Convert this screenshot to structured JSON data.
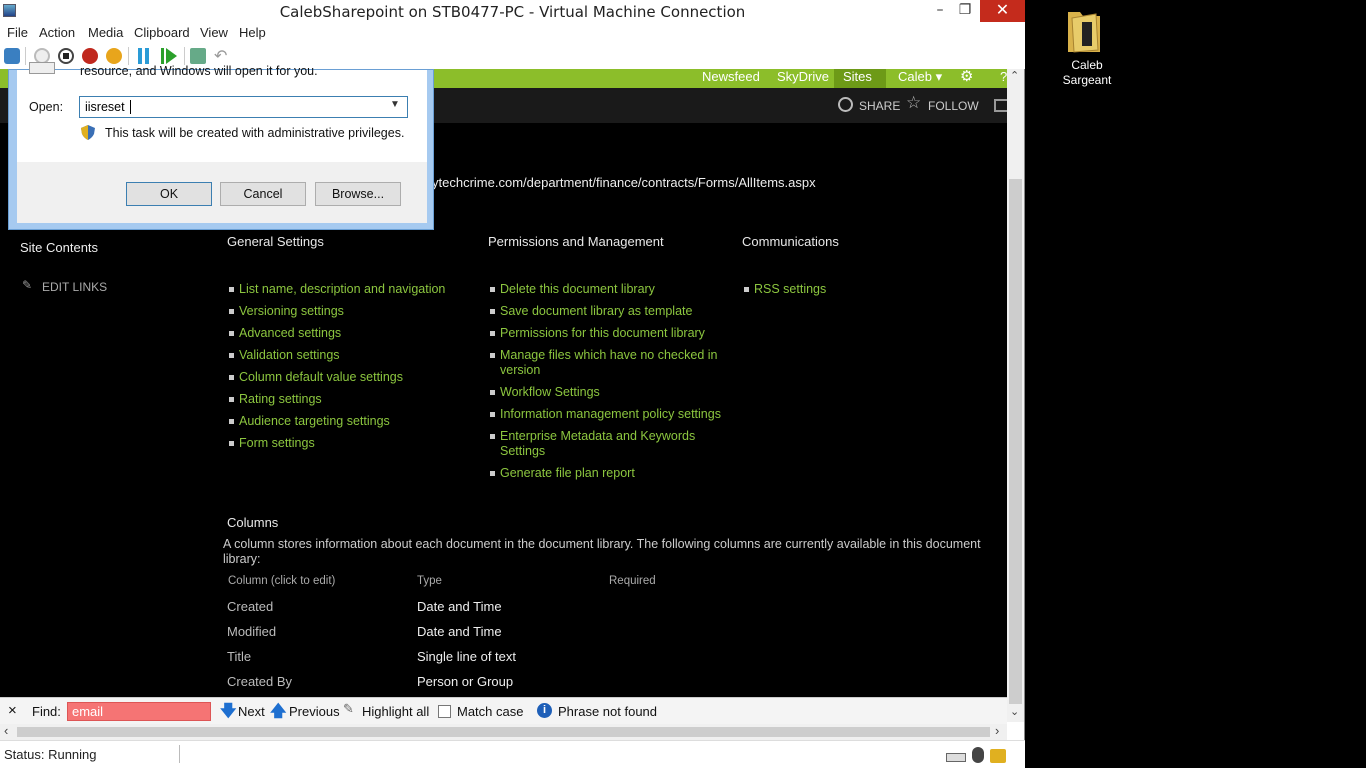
{
  "window": {
    "title": "CalebSharepoint on STB0477-PC - Virtual Machine Connection",
    "controls": {
      "minimize": "–",
      "restore": "❐",
      "close": "✕"
    }
  },
  "menu": [
    "File",
    "Action",
    "Media",
    "Clipboard",
    "View",
    "Help"
  ],
  "suite_nav": {
    "newsfeed": "Newsfeed",
    "skydrive": "SkyDrive",
    "sites": "Sites",
    "user": "Caleb ▾",
    "settings_icon": "⚙",
    "help_icon": "?"
  },
  "actions": {
    "share": "SHARE",
    "follow": "FOLLOW"
  },
  "url_fragment": "ytechcrime.com/department/finance/contracts/Forms/AllItems.aspx",
  "left_nav": {
    "site_contents": "Site Contents",
    "edit_links": "EDIT LINKS"
  },
  "sections": {
    "general": {
      "title": "General Settings",
      "links": [
        "List name, description and navigation",
        "Versioning settings",
        "Advanced settings",
        "Validation settings",
        "Column default value settings",
        "Rating settings",
        "Audience targeting settings",
        "Form settings"
      ]
    },
    "permissions": {
      "title": "Permissions and Management",
      "links": [
        "Delete this document library",
        "Save document library as template",
        "Permissions for this document library",
        "Manage files which have no checked in",
        "version",
        "Workflow Settings",
        "Information management policy settings",
        "Enterprise Metadata and Keywords",
        "Settings",
        "Generate file plan report"
      ]
    },
    "communications": {
      "title": "Communications",
      "links": [
        "RSS settings"
      ]
    }
  },
  "columns": {
    "title": "Columns",
    "desc1": "A column stores information about each document in the document library. The following columns are currently available in this document",
    "desc2": "library:",
    "headers": [
      "Column (click to edit)",
      "Type",
      "Required"
    ],
    "rows": [
      {
        "name": "Created",
        "type": "Date and Time"
      },
      {
        "name": "Modified",
        "type": "Date and Time"
      },
      {
        "name": "Title",
        "type": "Single line of text"
      },
      {
        "name": "Created By",
        "type": "Person or Group"
      }
    ]
  },
  "run_dialog": {
    "desc_fragment": "resource, and Windows will open it for you.",
    "open_label": "Open:",
    "open_value": "iisreset",
    "admin_note": "This task will be created with administrative privileges.",
    "ok": "OK",
    "cancel": "Cancel",
    "browse": "Browse..."
  },
  "find_bar": {
    "close": "×",
    "label": "Find:",
    "value": "email",
    "next": "Next",
    "previous": "Previous",
    "highlight": "Highlight all",
    "match_case": "Match case",
    "status": "Phrase not found"
  },
  "status": {
    "text": "Status: Running"
  },
  "desktop": {
    "folder_label_1": "Caleb",
    "folder_label_2": "Sargeant"
  },
  "colors": {
    "suite_green": "#8cbe2a",
    "link_green": "#8cc63f",
    "find_error": "#f57474",
    "close_red": "#c42b1c"
  }
}
